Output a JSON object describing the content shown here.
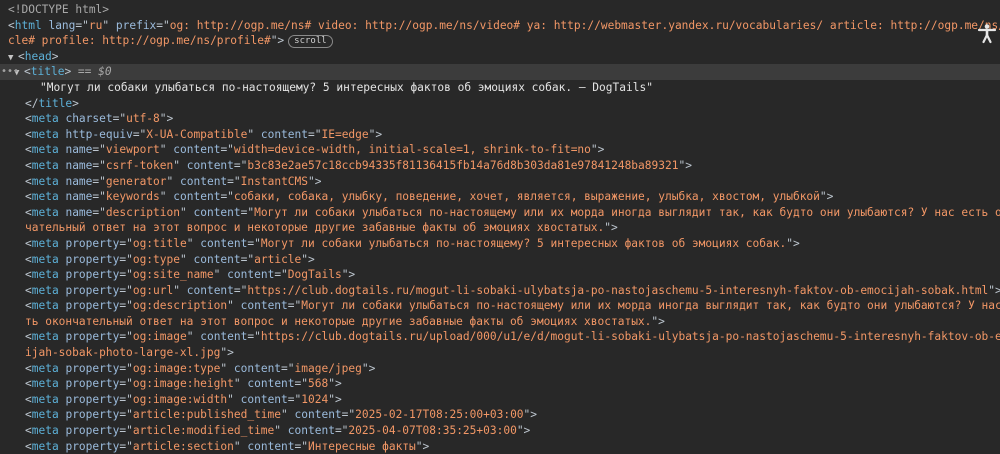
{
  "lines": [
    {
      "indent": 1,
      "parts": [
        [
          "doc",
          "<!DOCTYPE html>"
        ]
      ]
    },
    {
      "indent": 1,
      "parts": [
        [
          "punc",
          "<"
        ],
        [
          "tag",
          "html"
        ],
        [
          "txt",
          " "
        ],
        [
          "attr",
          "lang"
        ],
        [
          "punc",
          "=\""
        ],
        [
          "val",
          "ru"
        ],
        [
          "punc",
          "\""
        ],
        [
          "txt",
          " "
        ],
        [
          "attr",
          "prefix"
        ],
        [
          "punc",
          "=\""
        ],
        [
          "val",
          "og: http://ogp.me/ns# video: http://ogp.me/ns/video# ya: http://webmaster.yandex.ru/vocabularies/ article: http://ogp.me/ns/arti"
        ]
      ]
    },
    {
      "indent": 1,
      "parts": [
        [
          "val",
          "cle# profile: http://ogp.me/ns/profile#"
        ],
        [
          "punc",
          "\">"
        ]
      ],
      "badge": "scroll"
    },
    {
      "indent": 1,
      "arrow": "▼",
      "parts": [
        [
          "punc",
          "<"
        ],
        [
          "tag",
          "head"
        ],
        [
          "punc",
          ">"
        ]
      ]
    },
    {
      "indent": 2,
      "arrow": "▼",
      "selected": true,
      "dots": "•••",
      "parts": [
        [
          "punc",
          "<"
        ],
        [
          "tag",
          "title"
        ],
        [
          "punc",
          ">"
        ],
        [
          "eq",
          " == $0"
        ]
      ]
    },
    {
      "indent": 4,
      "parts": [
        [
          "txt",
          "\"Могут ли собаки улыбаться по-настоящему? 5 интересных фактов об эмоциях собак. — DogTails\""
        ]
      ]
    },
    {
      "indent": 3,
      "parts": [
        [
          "punc",
          "</"
        ],
        [
          "tag",
          "title"
        ],
        [
          "punc",
          ">"
        ]
      ]
    },
    {
      "indent": 3,
      "parts": [
        [
          "punc",
          "<"
        ],
        [
          "tag",
          "meta"
        ],
        [
          "txt",
          " "
        ],
        [
          "attr",
          "charset"
        ],
        [
          "punc",
          "=\""
        ],
        [
          "val",
          "utf-8"
        ],
        [
          "punc",
          "\">"
        ]
      ]
    },
    {
      "indent": 3,
      "parts": [
        [
          "punc",
          "<"
        ],
        [
          "tag",
          "meta"
        ],
        [
          "txt",
          " "
        ],
        [
          "attr",
          "http-equiv"
        ],
        [
          "punc",
          "=\""
        ],
        [
          "val",
          "X-UA-Compatible"
        ],
        [
          "punc",
          "\""
        ],
        [
          "txt",
          " "
        ],
        [
          "attr",
          "content"
        ],
        [
          "punc",
          "=\""
        ],
        [
          "val",
          "IE=edge"
        ],
        [
          "punc",
          "\">"
        ]
      ]
    },
    {
      "indent": 3,
      "parts": [
        [
          "punc",
          "<"
        ],
        [
          "tag",
          "meta"
        ],
        [
          "txt",
          " "
        ],
        [
          "attr",
          "name"
        ],
        [
          "punc",
          "=\""
        ],
        [
          "val",
          "viewport"
        ],
        [
          "punc",
          "\""
        ],
        [
          "txt",
          " "
        ],
        [
          "attr",
          "content"
        ],
        [
          "punc",
          "=\""
        ],
        [
          "val",
          "width=device-width, initial-scale=1, shrink-to-fit=no"
        ],
        [
          "punc",
          "\">"
        ]
      ]
    },
    {
      "indent": 3,
      "parts": [
        [
          "punc",
          "<"
        ],
        [
          "tag",
          "meta"
        ],
        [
          "txt",
          " "
        ],
        [
          "attr",
          "name"
        ],
        [
          "punc",
          "=\""
        ],
        [
          "val",
          "csrf-token"
        ],
        [
          "punc",
          "\""
        ],
        [
          "txt",
          " "
        ],
        [
          "attr",
          "content"
        ],
        [
          "punc",
          "=\""
        ],
        [
          "val",
          "b3c83e2ae57c18ccb94335f81136415fb14a76d8b303da81e97841248ba89321"
        ],
        [
          "punc",
          "\">"
        ]
      ]
    },
    {
      "indent": 3,
      "parts": [
        [
          "punc",
          "<"
        ],
        [
          "tag",
          "meta"
        ],
        [
          "txt",
          " "
        ],
        [
          "attr",
          "name"
        ],
        [
          "punc",
          "=\""
        ],
        [
          "val",
          "generator"
        ],
        [
          "punc",
          "\""
        ],
        [
          "txt",
          " "
        ],
        [
          "attr",
          "content"
        ],
        [
          "punc",
          "=\""
        ],
        [
          "val",
          "InstantCMS"
        ],
        [
          "punc",
          "\">"
        ]
      ]
    },
    {
      "indent": 3,
      "parts": [
        [
          "punc",
          "<"
        ],
        [
          "tag",
          "meta"
        ],
        [
          "txt",
          " "
        ],
        [
          "attr",
          "name"
        ],
        [
          "punc",
          "=\""
        ],
        [
          "val",
          "keywords"
        ],
        [
          "punc",
          "\""
        ],
        [
          "txt",
          " "
        ],
        [
          "attr",
          "content"
        ],
        [
          "punc",
          "=\""
        ],
        [
          "val",
          "собаки, собака, улыбку, поведение, хочет, является, выражение, улыбка, хвостом, улыбкой"
        ],
        [
          "punc",
          "\">"
        ]
      ]
    },
    {
      "indent": 3,
      "parts": [
        [
          "punc",
          "<"
        ],
        [
          "tag",
          "meta"
        ],
        [
          "txt",
          " "
        ],
        [
          "attr",
          "name"
        ],
        [
          "punc",
          "=\""
        ],
        [
          "val",
          "description"
        ],
        [
          "punc",
          "\""
        ],
        [
          "txt",
          " "
        ],
        [
          "attr",
          "content"
        ],
        [
          "punc",
          "=\""
        ],
        [
          "val",
          "Могут ли собаки улыбаться по-настоящему или их морда иногда выглядит так, как будто они улыбаются? У нас есть окон"
        ]
      ]
    },
    {
      "indent": 3,
      "parts": [
        [
          "val",
          "чательный ответ на этот вопрос и некоторые другие забавные факты об эмоциях хвостатых."
        ],
        [
          "punc",
          "\">"
        ]
      ]
    },
    {
      "indent": 3,
      "parts": [
        [
          "punc",
          "<"
        ],
        [
          "tag",
          "meta"
        ],
        [
          "txt",
          " "
        ],
        [
          "attr",
          "property"
        ],
        [
          "punc",
          "=\""
        ],
        [
          "val",
          "og:title"
        ],
        [
          "punc",
          "\""
        ],
        [
          "txt",
          " "
        ],
        [
          "attr",
          "content"
        ],
        [
          "punc",
          "=\""
        ],
        [
          "val",
          "Могут ли собаки улыбаться по-настоящему? 5 интересных фактов об эмоциях собак."
        ],
        [
          "punc",
          "\">"
        ]
      ]
    },
    {
      "indent": 3,
      "parts": [
        [
          "punc",
          "<"
        ],
        [
          "tag",
          "meta"
        ],
        [
          "txt",
          " "
        ],
        [
          "attr",
          "property"
        ],
        [
          "punc",
          "=\""
        ],
        [
          "val",
          "og:type"
        ],
        [
          "punc",
          "\""
        ],
        [
          "txt",
          " "
        ],
        [
          "attr",
          "content"
        ],
        [
          "punc",
          "=\""
        ],
        [
          "val",
          "article"
        ],
        [
          "punc",
          "\">"
        ]
      ]
    },
    {
      "indent": 3,
      "parts": [
        [
          "punc",
          "<"
        ],
        [
          "tag",
          "meta"
        ],
        [
          "txt",
          " "
        ],
        [
          "attr",
          "property"
        ],
        [
          "punc",
          "=\""
        ],
        [
          "val",
          "og:site_name"
        ],
        [
          "punc",
          "\""
        ],
        [
          "txt",
          " "
        ],
        [
          "attr",
          "content"
        ],
        [
          "punc",
          "=\""
        ],
        [
          "val",
          "DogTails"
        ],
        [
          "punc",
          "\">"
        ]
      ]
    },
    {
      "indent": 3,
      "parts": [
        [
          "punc",
          "<"
        ],
        [
          "tag",
          "meta"
        ],
        [
          "txt",
          " "
        ],
        [
          "attr",
          "property"
        ],
        [
          "punc",
          "=\""
        ],
        [
          "val",
          "og:url"
        ],
        [
          "punc",
          "\""
        ],
        [
          "txt",
          " "
        ],
        [
          "attr",
          "content"
        ],
        [
          "punc",
          "=\""
        ],
        [
          "val",
          "https://club.dogtails.ru/mogut-li-sobaki-ulybatsja-po-nastojaschemu-5-interesnyh-faktov-ob-emocijah-sobak.html"
        ],
        [
          "punc",
          "\">"
        ]
      ]
    },
    {
      "indent": 3,
      "parts": [
        [
          "punc",
          "<"
        ],
        [
          "tag",
          "meta"
        ],
        [
          "txt",
          " "
        ],
        [
          "attr",
          "property"
        ],
        [
          "punc",
          "=\""
        ],
        [
          "val",
          "og:description"
        ],
        [
          "punc",
          "\""
        ],
        [
          "txt",
          " "
        ],
        [
          "attr",
          "content"
        ],
        [
          "punc",
          "=\""
        ],
        [
          "val",
          "Могут ли собаки улыбаться по-настоящему или их морда иногда выглядит так, как будто они улыбаются? У нас ес"
        ]
      ]
    },
    {
      "indent": 3,
      "parts": [
        [
          "val",
          "ть окончательный ответ на этот вопрос и некоторые другие забавные факты об эмоциях хвостатых."
        ],
        [
          "punc",
          "\">"
        ]
      ]
    },
    {
      "indent": 3,
      "parts": [
        [
          "punc",
          "<"
        ],
        [
          "tag",
          "meta"
        ],
        [
          "txt",
          " "
        ],
        [
          "attr",
          "property"
        ],
        [
          "punc",
          "=\""
        ],
        [
          "val",
          "og:image"
        ],
        [
          "punc",
          "\""
        ],
        [
          "txt",
          " "
        ],
        [
          "attr",
          "content"
        ],
        [
          "punc",
          "=\""
        ],
        [
          "val",
          "https://club.dogtails.ru/upload/000/u1/e/d/mogut-li-sobaki-ulybatsja-po-nastojaschemu-5-interesnyh-faktov-ob-emoc"
        ]
      ]
    },
    {
      "indent": 3,
      "parts": [
        [
          "val",
          "ijah-sobak-photo-large-xl.jpg"
        ],
        [
          "punc",
          "\">"
        ]
      ]
    },
    {
      "indent": 3,
      "parts": [
        [
          "punc",
          "<"
        ],
        [
          "tag",
          "meta"
        ],
        [
          "txt",
          " "
        ],
        [
          "attr",
          "property"
        ],
        [
          "punc",
          "=\""
        ],
        [
          "val",
          "og:image:type"
        ],
        [
          "punc",
          "\""
        ],
        [
          "txt",
          " "
        ],
        [
          "attr",
          "content"
        ],
        [
          "punc",
          "=\""
        ],
        [
          "val",
          "image/jpeg"
        ],
        [
          "punc",
          "\">"
        ]
      ]
    },
    {
      "indent": 3,
      "parts": [
        [
          "punc",
          "<"
        ],
        [
          "tag",
          "meta"
        ],
        [
          "txt",
          " "
        ],
        [
          "attr",
          "property"
        ],
        [
          "punc",
          "=\""
        ],
        [
          "val",
          "og:image:height"
        ],
        [
          "punc",
          "\""
        ],
        [
          "txt",
          " "
        ],
        [
          "attr",
          "content"
        ],
        [
          "punc",
          "=\""
        ],
        [
          "val",
          "568"
        ],
        [
          "punc",
          "\">"
        ]
      ]
    },
    {
      "indent": 3,
      "parts": [
        [
          "punc",
          "<"
        ],
        [
          "tag",
          "meta"
        ],
        [
          "txt",
          " "
        ],
        [
          "attr",
          "property"
        ],
        [
          "punc",
          "=\""
        ],
        [
          "val",
          "og:image:width"
        ],
        [
          "punc",
          "\""
        ],
        [
          "txt",
          " "
        ],
        [
          "attr",
          "content"
        ],
        [
          "punc",
          "=\""
        ],
        [
          "val",
          "1024"
        ],
        [
          "punc",
          "\">"
        ]
      ]
    },
    {
      "indent": 3,
      "parts": [
        [
          "punc",
          "<"
        ],
        [
          "tag",
          "meta"
        ],
        [
          "txt",
          " "
        ],
        [
          "attr",
          "property"
        ],
        [
          "punc",
          "=\""
        ],
        [
          "val",
          "article:published_time"
        ],
        [
          "punc",
          "\""
        ],
        [
          "txt",
          " "
        ],
        [
          "attr",
          "content"
        ],
        [
          "punc",
          "=\""
        ],
        [
          "val",
          "2025-02-17T08:25:00+03:00"
        ],
        [
          "punc",
          "\">"
        ]
      ]
    },
    {
      "indent": 3,
      "parts": [
        [
          "punc",
          "<"
        ],
        [
          "tag",
          "meta"
        ],
        [
          "txt",
          " "
        ],
        [
          "attr",
          "property"
        ],
        [
          "punc",
          "=\""
        ],
        [
          "val",
          "article:modified_time"
        ],
        [
          "punc",
          "\""
        ],
        [
          "txt",
          " "
        ],
        [
          "attr",
          "content"
        ],
        [
          "punc",
          "=\""
        ],
        [
          "val",
          "2025-04-07T08:35:25+03:00"
        ],
        [
          "punc",
          "\">"
        ]
      ]
    },
    {
      "indent": 3,
      "parts": [
        [
          "punc",
          "<"
        ],
        [
          "tag",
          "meta"
        ],
        [
          "txt",
          " "
        ],
        [
          "attr",
          "property"
        ],
        [
          "punc",
          "=\""
        ],
        [
          "val",
          "article:section"
        ],
        [
          "punc",
          "\""
        ],
        [
          "txt",
          " "
        ],
        [
          "attr",
          "content"
        ],
        [
          "punc",
          "=\""
        ],
        [
          "val",
          "Интересные факты"
        ],
        [
          "punc",
          "\">"
        ]
      ]
    }
  ]
}
